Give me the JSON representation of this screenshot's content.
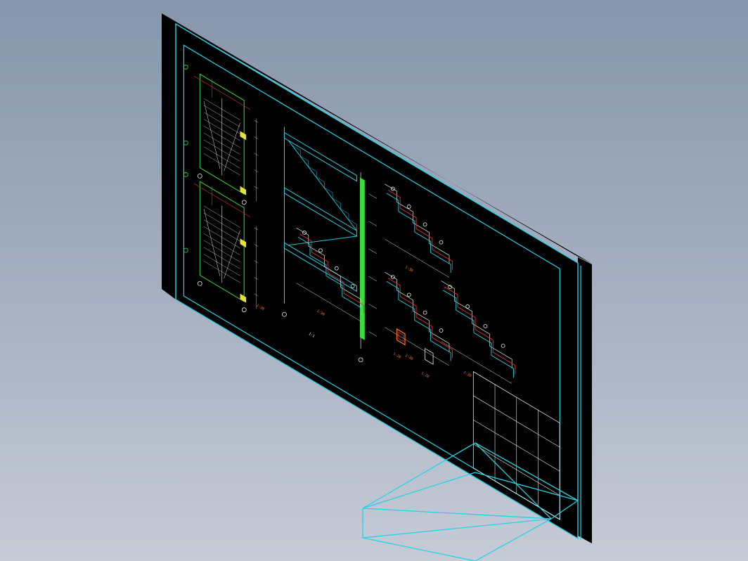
{
  "viewport": {
    "background_top": "#8796ab",
    "background_bottom": "#c6cbd6"
  },
  "drawing": {
    "sheet_fill": "#000000",
    "frame_color": "#22d3e6",
    "line_white": "#e8e8e8",
    "line_green": "#3ddc3d",
    "line_yellow": "#e8e03a",
    "line_red": "#e23030",
    "line_cyan": "#22d3e6",
    "line_orange": "#ff7a1a",
    "title_block_rows": 4,
    "title_block_cols": 4,
    "scale_labels": [
      "1:30",
      "1:30",
      "1:30",
      "1:20",
      "1:30",
      "1:20",
      "1:30"
    ]
  },
  "icons": {
    "grid_bubble": "grid-bubble-icon",
    "level_marker": "elevation-marker-icon",
    "section_arrow": "section-arrow-icon"
  }
}
